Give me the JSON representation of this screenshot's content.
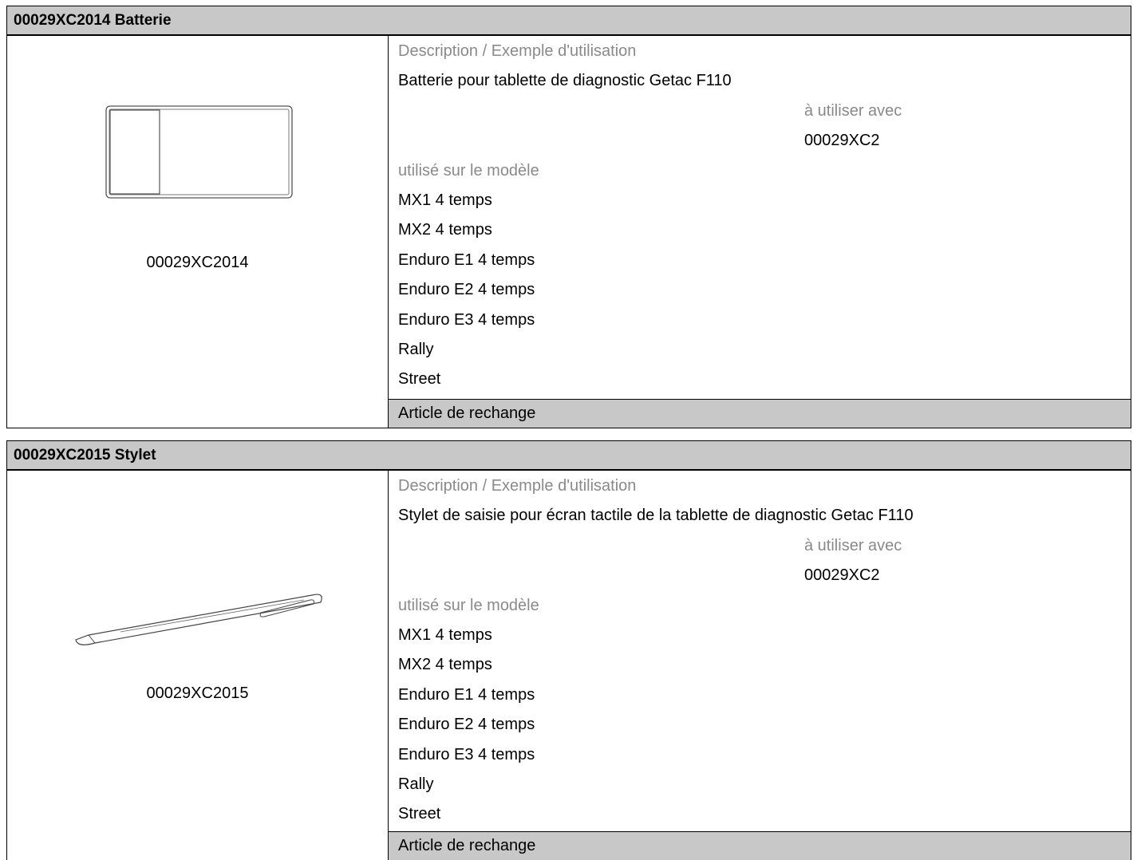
{
  "items": [
    {
      "header": "00029XC2014 Batterie",
      "image_caption": "00029XC2014",
      "image_icon": "battery-icon",
      "description_label": "Description / Exemple d'utilisation",
      "description": "Batterie pour tablette de diagnostic Getac F110",
      "use_with_label": "à utiliser avec",
      "use_with_value": "00029XC2",
      "models_label": "utilisé sur le modèle",
      "models": [
        "MX1 4 temps",
        "MX2 4 temps",
        "Enduro E1 4 temps",
        "Enduro E2 4 temps",
        "Enduro E3 4 temps",
        "Rally",
        "Street"
      ],
      "spare_part_label": "Article de rechange"
    },
    {
      "header": "00029XC2015 Stylet",
      "image_caption": "00029XC2015",
      "image_icon": "stylus-icon",
      "description_label": "Description / Exemple d'utilisation",
      "description": "Stylet de saisie pour écran tactile de la tablette de diagnostic Getac F110",
      "use_with_label": "à utiliser avec",
      "use_with_value": "00029XC2",
      "models_label": "utilisé sur le modèle",
      "models": [
        "MX1 4 temps",
        "MX2 4 temps",
        "Enduro E1 4 temps",
        "Enduro E2 4 temps",
        "Enduro E3 4 temps",
        "Rally",
        "Street"
      ],
      "spare_part_label": "Article de rechange"
    }
  ]
}
